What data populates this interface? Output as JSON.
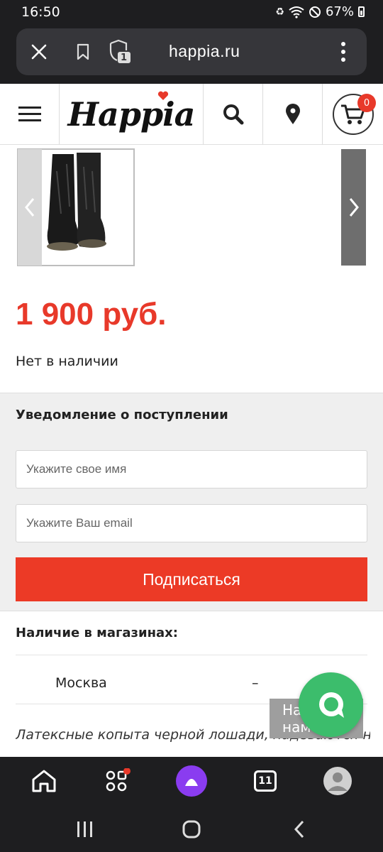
{
  "status": {
    "time": "16:50",
    "battery": "67%"
  },
  "browser": {
    "url": "happia.ru",
    "tab_count": "1"
  },
  "site": {
    "logo": "Happia",
    "cart_count": "0"
  },
  "product": {
    "price": "1 900 руб.",
    "stock": "Нет в наличии",
    "description": "Латексные копыта черной лошади, надеваются на"
  },
  "notify": {
    "title": "Уведомление о поступлении",
    "name_placeholder": "Укажите свое имя",
    "email_placeholder": "Укажите Ваш email",
    "subscribe_label": "Подписаться"
  },
  "availability": {
    "title": "Наличие в магазинах:",
    "stores": [
      {
        "name": "Москва",
        "value": "–"
      }
    ]
  },
  "chat": {
    "label": "Напишите нам"
  },
  "toolbar": {
    "tabs_count": "11"
  },
  "colors": {
    "accent": "#e8392a",
    "chat": "#3cbd6c",
    "alice": "#8a3cf0"
  }
}
